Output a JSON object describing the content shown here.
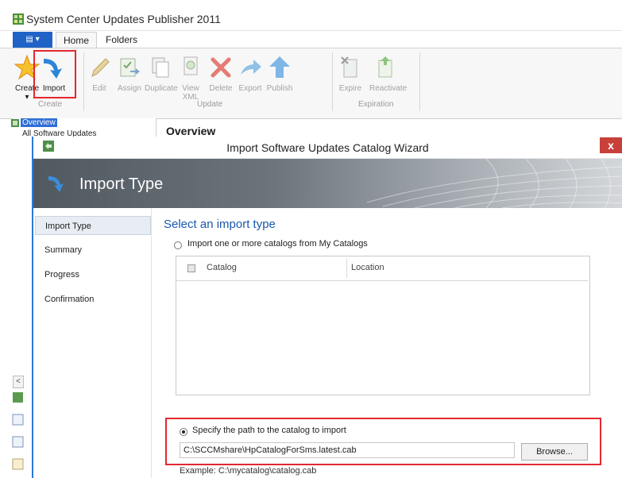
{
  "window": {
    "title": "System Center Updates Publisher 2011"
  },
  "tabs": {
    "home": "Home",
    "folders": "Folders"
  },
  "ribbon": {
    "create_group": "Create",
    "update_group": "Update",
    "expiration_group": "Expiration",
    "buttons": {
      "create": "Create",
      "import": "Import",
      "edit": "Edit",
      "assign": "Assign",
      "duplicate": "Duplicate",
      "view_xml_1": "View",
      "view_xml_2": "XML",
      "delete": "Delete",
      "export": "Export",
      "publish": "Publish",
      "expire": "Expire",
      "reactivate": "Reactivate"
    }
  },
  "nav": {
    "overview": "Overview",
    "all_updates": "All Software Updates"
  },
  "main": {
    "title": "Overview"
  },
  "dialog": {
    "title": "Import Software Updates Catalog Wizard",
    "close_label": "x",
    "banner_title": "Import Type",
    "steps": [
      "Import Type",
      "Summary",
      "Progress",
      "Confirmation"
    ],
    "heading": "Select an import type",
    "option1_label": "Import one or more catalogs from My Catalogs",
    "table_columns": {
      "catalog": "Catalog",
      "location": "Location"
    },
    "option2_label": "Specify the path to the catalog to import",
    "path_value": "C:\\SCCMshare\\HpCatalogForSms.latest.cab",
    "browse_label": "Browse...",
    "example": "Example: C:\\mycatalog\\catalog.cab"
  },
  "colors": {
    "highlight": "#e3282f",
    "accent": "#1f63c7",
    "heading": "#1a58ae"
  }
}
